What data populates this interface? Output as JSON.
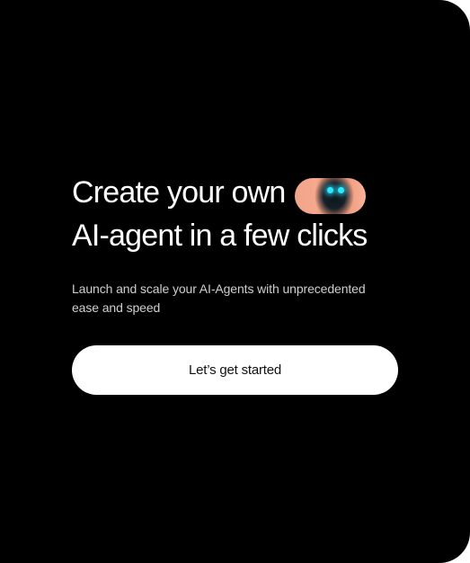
{
  "hero": {
    "headline_line1": "Create your own",
    "headline_line2": "AI-agent in a few clicks",
    "subtitle": "Launch and scale your AI-Agents with unprecedented ease and speed",
    "cta_label": "Let’s get started"
  },
  "media": {
    "pill_icon": "robot-face-icon",
    "eye_color": "#2ee8ff"
  },
  "colors": {
    "background": "#000000",
    "text": "#ffffff",
    "subtitle_text": "#cfcfcf",
    "button_bg": "#ffffff",
    "button_text": "#111111"
  }
}
